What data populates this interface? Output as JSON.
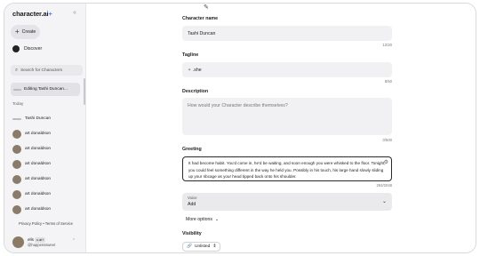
{
  "sidebar": {
    "logo": "character.ai",
    "logo_plus": "+",
    "collapse_icon": "«",
    "create_label": "Create",
    "discover_label": "Discover",
    "search_placeholder": "Search for Characters",
    "editing_label": "Editing Tashi Duncan...",
    "section_today": "Today",
    "chats": [
      {
        "name": "Tashi Duncan"
      },
      {
        "name": "art donaldson"
      },
      {
        "name": "art donaldson"
      },
      {
        "name": "art donaldson"
      },
      {
        "name": "art donaldson"
      },
      {
        "name": "art donaldson"
      },
      {
        "name": "art donaldson"
      }
    ],
    "footer_links": "Privacy Policy  •  Terms of Service",
    "user": {
      "name": "ells",
      "badge": "c.ai+",
      "handle": "@happenssweet"
    }
  },
  "main": {
    "top_icon": "✎",
    "character_name": {
      "label": "Character name",
      "value": "Tashi Duncan",
      "counter": "12/20"
    },
    "tagline": {
      "label": "Tagline",
      "value": ".she",
      "counter": "8/50"
    },
    "description": {
      "label": "Description",
      "placeholder": "How would your Character describe themselves?",
      "counter": "0/500"
    },
    "greeting": {
      "label": "Greeting",
      "value": "It had become habit. You'd come in, he'd be waiting, and soon enough you were whisked to the floor. Tonight, you could feel something different in the way he held you. Possibly in his touch, his large hand slowly sliding up your ribcage as your head tipped back onto his shoulder.",
      "counter": "284/2048"
    },
    "voice": {
      "label": "Voice",
      "value": "Add"
    },
    "more_options": "More options",
    "visibility": {
      "label": "Visibility",
      "value": "Unlisted"
    }
  }
}
